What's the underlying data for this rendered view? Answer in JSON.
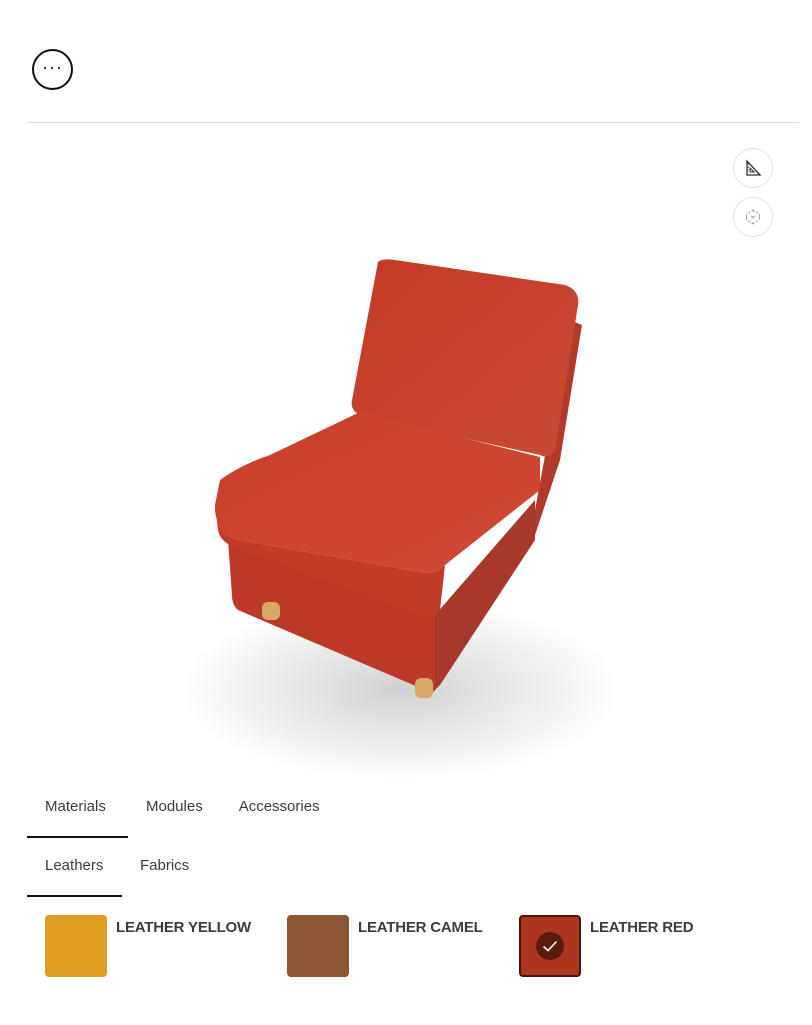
{
  "header": {
    "menu_icon": "more-horizontal-icon",
    "menu_glyph": "···"
  },
  "viewer": {
    "tools": [
      {
        "name": "measure",
        "icon": "ruler-triangle-icon"
      },
      {
        "name": "ar-view",
        "icon": "3d-cube-icon"
      }
    ],
    "product": "Leather armless chair module",
    "colors": {
      "leather": "#c23b26",
      "leather_light": "#d24a33",
      "leather_dark": "#a93222",
      "legs": "#d9a766"
    }
  },
  "tabs": [
    {
      "label": "Materials",
      "active": true
    },
    {
      "label": "Modules",
      "active": false
    },
    {
      "label": "Accessories",
      "active": false
    }
  ],
  "subtabs": [
    {
      "label": "Leathers",
      "active": true
    },
    {
      "label": "Fabrics",
      "active": false
    }
  ],
  "swatches": [
    {
      "label": "LEATHER YELLOW",
      "color": "#e09f22",
      "selected": false
    },
    {
      "label": "LEATHER CAMEL",
      "color": "#8b5631",
      "selected": false
    },
    {
      "label": "LEATHER RED",
      "color": "#ad3520",
      "selected": true
    }
  ]
}
